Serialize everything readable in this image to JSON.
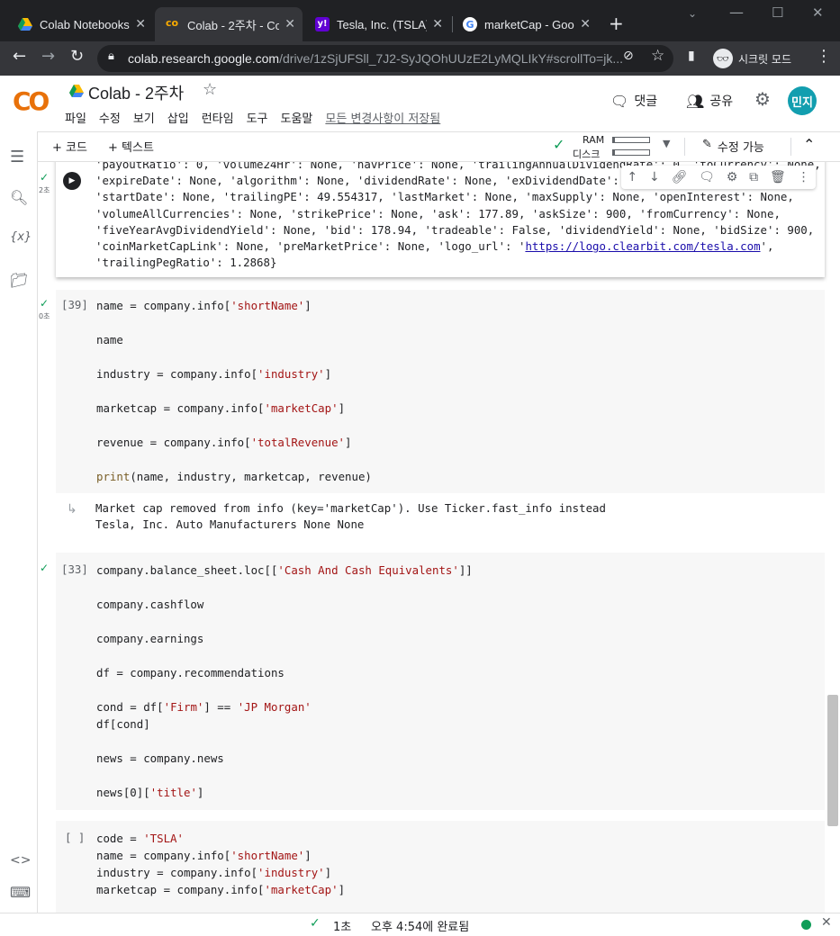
{
  "browser": {
    "tabs": [
      {
        "title": "Colab Notebooks",
        "icon": "google-drive-icon"
      },
      {
        "title": "Colab - 2주차 - Co",
        "icon": "colab-icon"
      },
      {
        "title": "Tesla, Inc. (TSLA) S",
        "icon": "yahoo-icon"
      },
      {
        "title": "marketCap - Goog",
        "icon": "google-icon"
      }
    ],
    "url_host": "colab.research.google.com",
    "url_path": "/drive/1zSjUFSll_7J2-SyJQOhUUzE2LyMQLIkY#scrollTo=jk...",
    "incognito_label": "시크릿 모드"
  },
  "colab": {
    "logo": "CO",
    "title": "Colab - 2주차",
    "menu": [
      "파일",
      "수정",
      "보기",
      "삽입",
      "런타임",
      "도구",
      "도움말"
    ],
    "saved_status": "모든 변경사항이 저장됨",
    "comment_label": "댓글",
    "share_label": "공유",
    "avatar": "민지",
    "add_code": "+ 코드",
    "add_text": "+ 텍스트",
    "ram_label": "RAM",
    "disk_label": "디스크",
    "ram_fill": 0.05,
    "disk_fill": 0.05,
    "edit_label": "수정 가능"
  },
  "cells": {
    "c0": {
      "time": "2초"
    },
    "c39": {
      "prompt": "[39]",
      "time": "0초",
      "output": [
        "Market cap removed from info (key='marketCap'). Use Ticker.fast_info instead",
        "Tesla, Inc. Auto Manufacturers None None"
      ]
    },
    "c33": {
      "prompt": "[33]"
    },
    "cnew": {
      "prompt": "[ ]"
    }
  },
  "status": {
    "time": "1초",
    "done": "오후 4:54에 완료됨"
  }
}
